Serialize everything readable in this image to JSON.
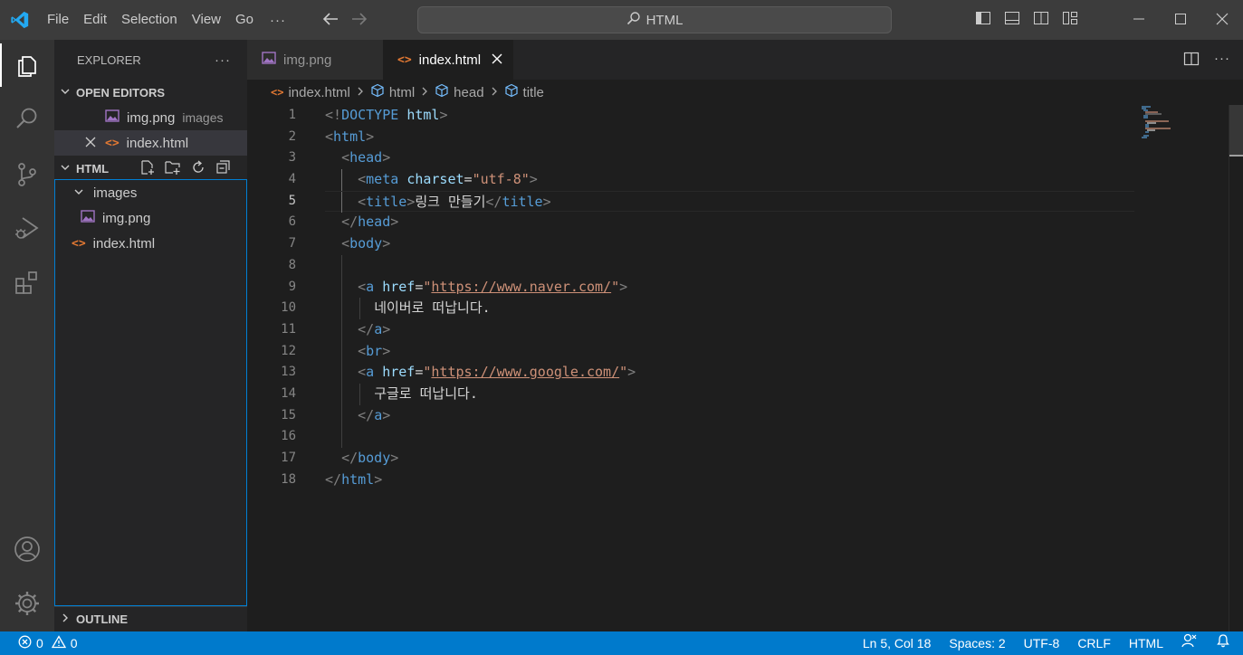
{
  "titlebar": {
    "menu": [
      "File",
      "Edit",
      "Selection",
      "View",
      "Go"
    ],
    "more": "···",
    "search": "HTML"
  },
  "sidebar": {
    "title": "EXPLORER",
    "more": "···",
    "open_editors_label": "OPEN EDITORS",
    "open_editors": [
      {
        "name": "img.png",
        "detail": "images"
      },
      {
        "name": "index.html",
        "detail": ""
      }
    ],
    "folder_label": "HTML",
    "tree": [
      {
        "name": "images"
      },
      {
        "name": "img.png"
      },
      {
        "name": "index.html"
      }
    ],
    "outline_label": "OUTLINE"
  },
  "tabs": [
    {
      "label": "img.png"
    },
    {
      "label": "index.html"
    }
  ],
  "breadcrumb": [
    "index.html",
    "html",
    "head",
    "title"
  ],
  "editor": {
    "lines": [
      "1",
      "2",
      "3",
      "4",
      "5",
      "6",
      "7",
      "8",
      "9",
      "10",
      "11",
      "12",
      "13",
      "14",
      "15",
      "16",
      "17",
      "18"
    ],
    "current_line": 5,
    "tokens": {
      "doctype_kw": "DOCTYPE",
      "doctype_html": "html",
      "html": "html",
      "head": "head",
      "meta": "meta",
      "charset_attr": "charset",
      "charset_val": "\"utf-8\"",
      "title": "title",
      "title_text": "링크 만들기",
      "body": "body",
      "a": "a",
      "href": "href",
      "quote": "\"",
      "naver_url": "https://www.naver.com/",
      "naver_text": "네이버로 떠납니다.",
      "br": "br",
      "google_url": "https://www.google.com/",
      "google_text": "구글로 떠납니다."
    }
  },
  "statusbar": {
    "errors": "0",
    "warnings": "0",
    "position": "Ln 5, Col 18",
    "spaces": "Spaces: 2",
    "encoding": "UTF-8",
    "eol": "CRLF",
    "language": "HTML"
  },
  "colors": {
    "accent": "#007acc",
    "tag": "#569cd6",
    "attr": "#9cdcfe",
    "string": "#ce9178",
    "html_icon": "#e37933",
    "image_icon": "#a074c4"
  }
}
